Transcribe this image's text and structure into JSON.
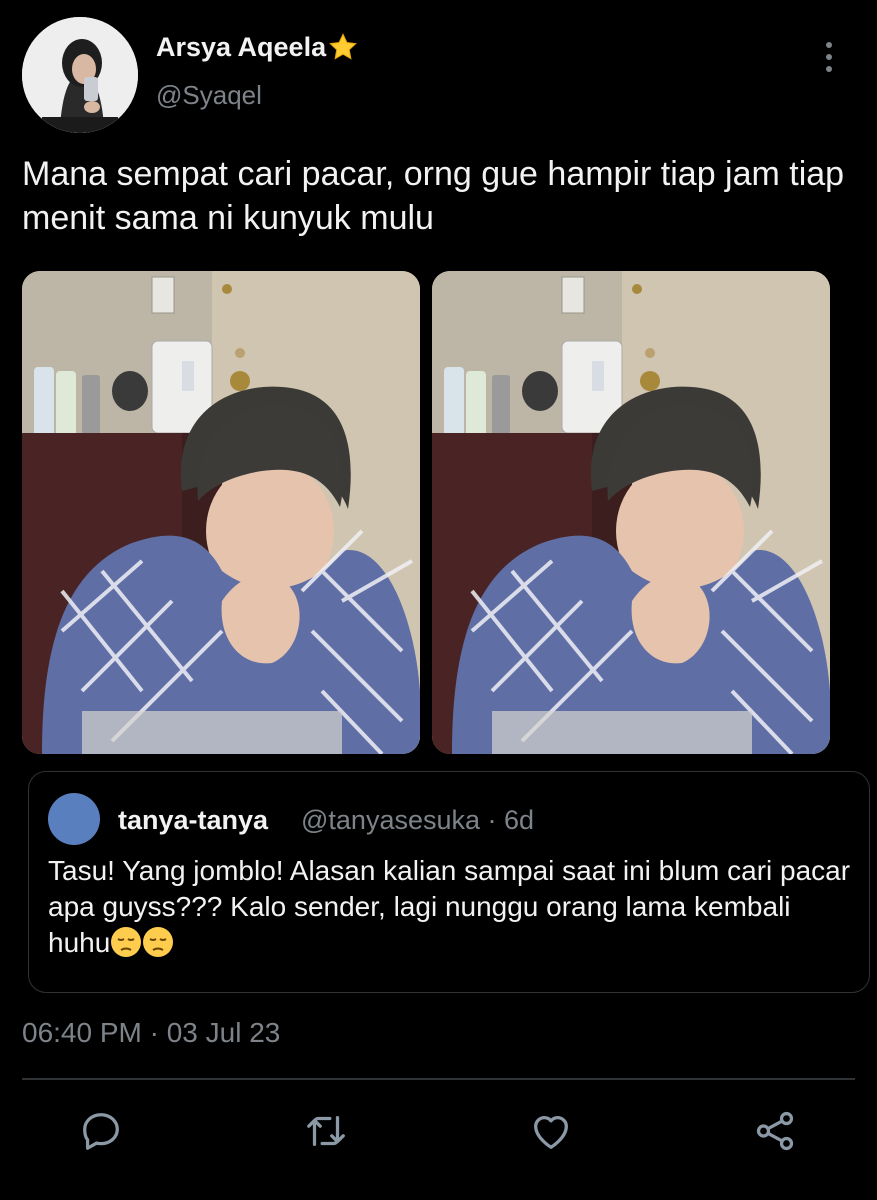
{
  "author": {
    "display_name": "Arsya Aqeela",
    "handle": "@Syaqel",
    "badge_icon": "star-emoji-icon"
  },
  "tweet": {
    "text": "Mana sempat cari pacar, orng gue hampir tiap jam tiap menit sama ni kunyuk mulu",
    "media_count": 2
  },
  "quoted": {
    "name": "tanya-tanya",
    "meta": "@tanyasesuka · 6d",
    "text": "Tasu! Yang jomblo! Alasan kalian sampai saat ini blum cari pacar apa guyss??? Kalo sender, lagi nunggu orang lama kembali huhu",
    "avatar_color": "#5a7fbf",
    "emojis": [
      "pensive-face-icon",
      "pensive-face-icon"
    ]
  },
  "timestamp": "06:40 PM · 03 Jul 23",
  "actions": [
    "reply-icon",
    "retweet-icon",
    "like-icon",
    "share-icon"
  ],
  "colors": {
    "background": "#000000",
    "text": "#f2f2f2",
    "muted": "#7d8389",
    "border": "#2f3336"
  }
}
